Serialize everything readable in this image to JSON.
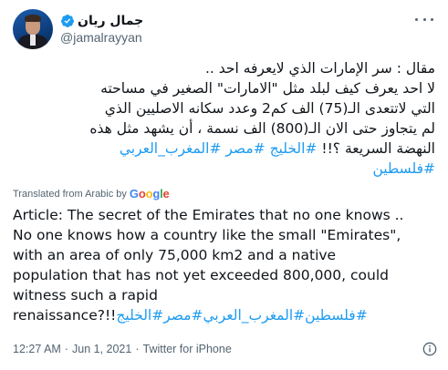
{
  "user": {
    "display_name": "جمال ريان",
    "handle": "@jamalrayyan",
    "verified": true
  },
  "tweet": {
    "arabic_lines": [
      "مقال : سر الإمارات الذي لايعرفه احد ..",
      "لا احد يعرف كيف لبلد مثل \"الامارات\" الصغير في مساحته",
      "التي لاتتعدى الـ(75) الف كم2 وعدد سكانه الاصليين الذي",
      "لم يتجاوز حتى الان الـ(800) الف نسمة ، أن يشهد مثل هذه"
    ],
    "arabic_line5_text": "النهضة السريعة ؟!! ",
    "arabic_line5_tags": "#الخليج #مصر #المغرب_العربي",
    "arabic_line6_tags": "#فلسطين"
  },
  "translation_notice": {
    "label": "Translated from Arabic by",
    "brand_letters": [
      "G",
      "o",
      "o",
      "g",
      "l",
      "e"
    ]
  },
  "translation": {
    "lines": [
      "Article: The secret of the Emirates that no one knows ..",
      " No one knows how a country like the small \"Emirates\",",
      "with an area of only 75,000 km2 and a native",
      "population that has not yet exceeded 800,000, could",
      "witness such a rapid"
    ],
    "last_text": "renaissance?!!",
    "last_tags": "#فلسطين#المغرب_العربي#مصر#الخليج"
  },
  "meta": {
    "time": "12:27 AM",
    "separator": "·",
    "date": "Jun 1, 2021",
    "source": "Twitter for iPhone"
  },
  "colors": {
    "link": "#1d9bf0",
    "text": "#0f1419",
    "secondary": "#536471",
    "verified": "#1d9bf0"
  },
  "icons": {
    "verified": "verified-badge-icon",
    "more": "more-options-icon",
    "info": "info-icon"
  }
}
